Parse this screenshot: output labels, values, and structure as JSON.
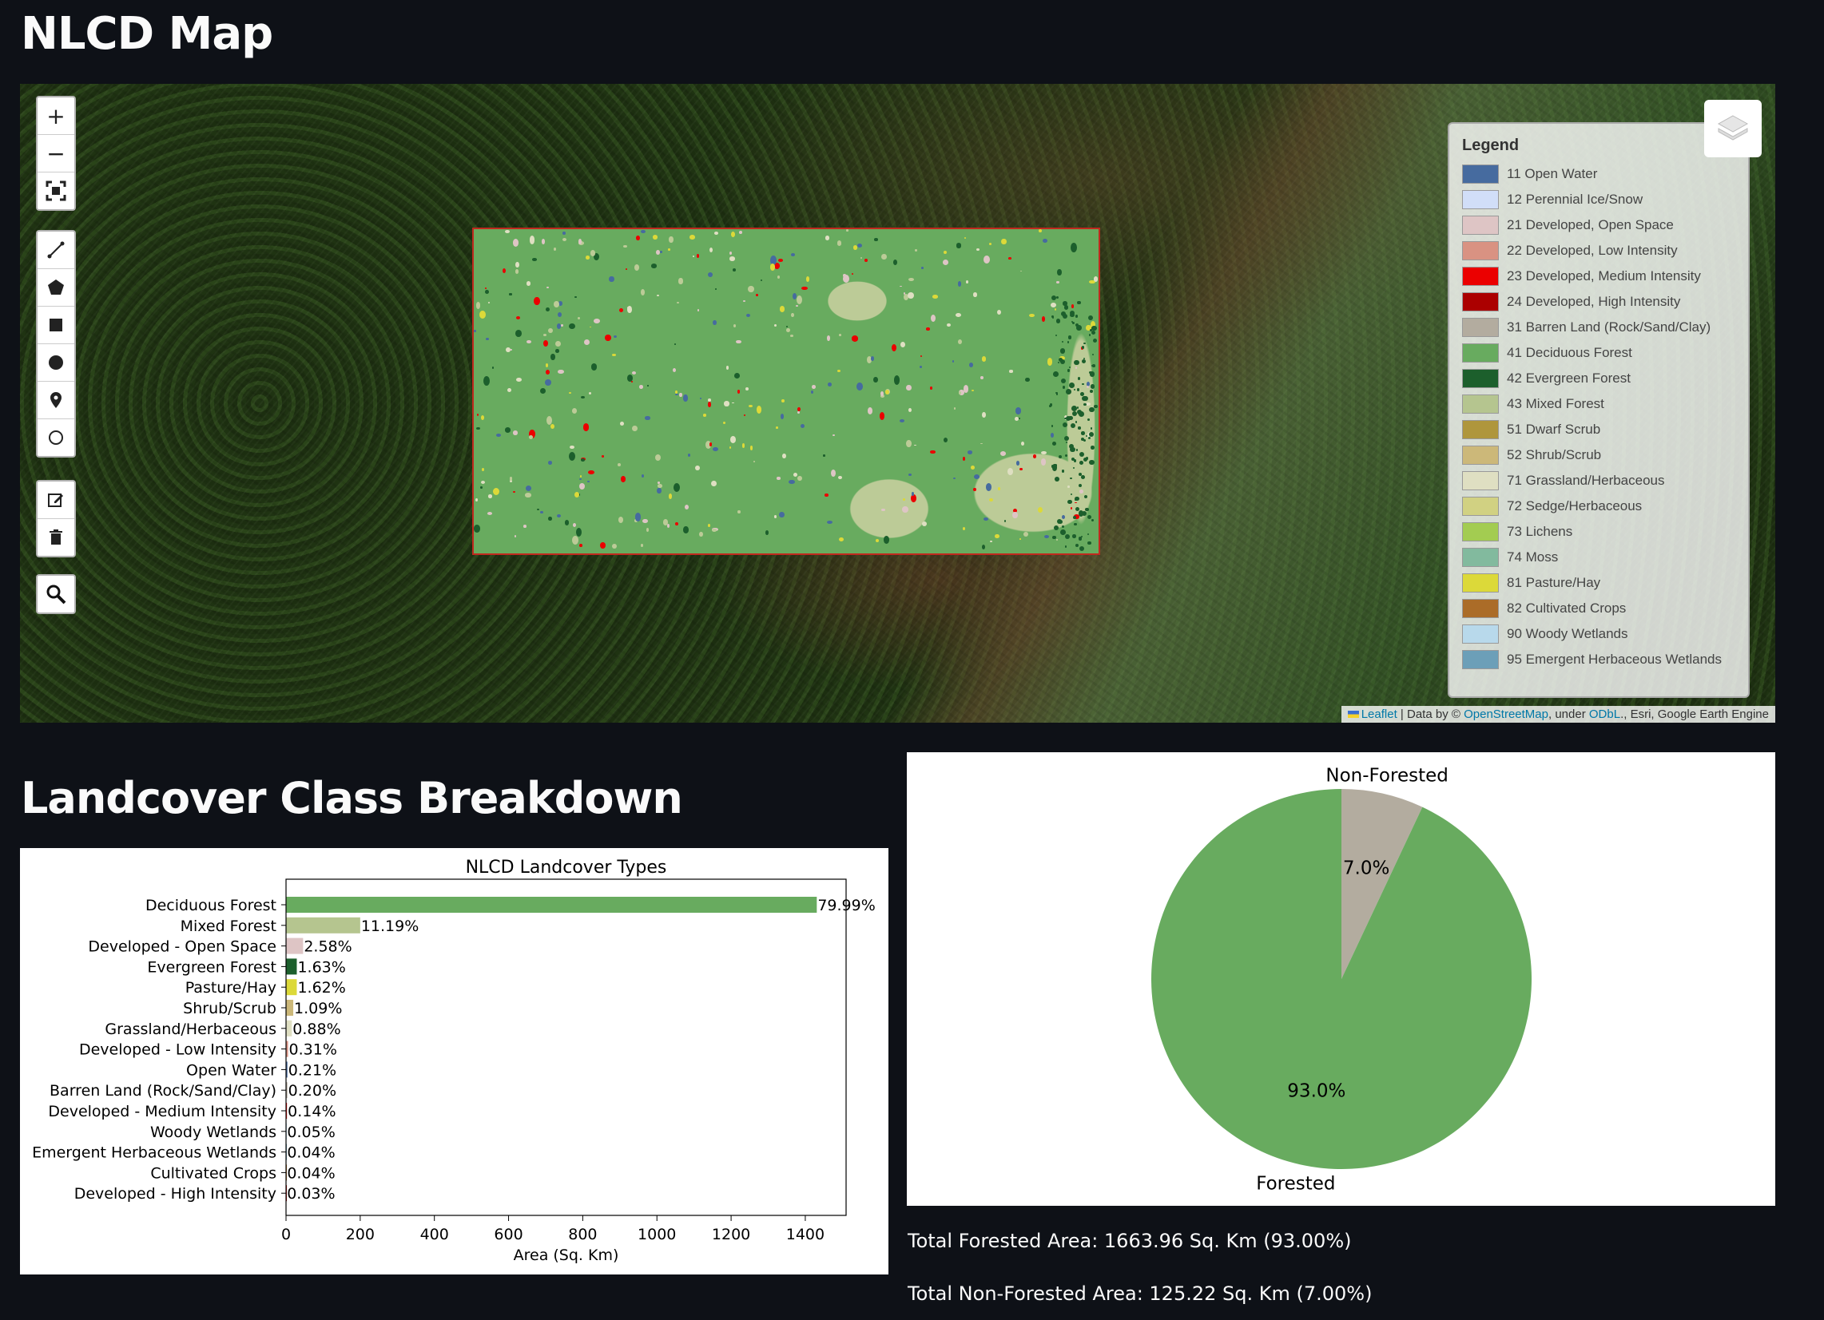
{
  "page": {
    "title": "NLCD Map",
    "section_title": "Landcover Class Breakdown"
  },
  "map": {
    "controls": {
      "zoom_in": "+",
      "zoom_out": "−"
    },
    "legend": {
      "title": "Legend",
      "items": [
        {
          "label": "11 Open Water",
          "color": "#466b9f"
        },
        {
          "label": "12 Perennial Ice/Snow",
          "color": "#d1def8"
        },
        {
          "label": "21 Developed, Open Space",
          "color": "#dec5c5"
        },
        {
          "label": "22 Developed, Low Intensity",
          "color": "#d99282"
        },
        {
          "label": "23 Developed, Medium Intensity",
          "color": "#eb0000"
        },
        {
          "label": "24 Developed, High Intensity",
          "color": "#ab0000"
        },
        {
          "label": "31 Barren Land (Rock/Sand/Clay)",
          "color": "#b3ac9f"
        },
        {
          "label": "41 Deciduous Forest",
          "color": "#68ab5f"
        },
        {
          "label": "42 Evergreen Forest",
          "color": "#1c5f2c"
        },
        {
          "label": "43 Mixed Forest",
          "color": "#b5c58f"
        },
        {
          "label": "51 Dwarf Scrub",
          "color": "#af963c"
        },
        {
          "label": "52 Shrub/Scrub",
          "color": "#ccb879"
        },
        {
          "label": "71 Grassland/Herbaceous",
          "color": "#dfdfc2"
        },
        {
          "label": "72 Sedge/Herbaceous",
          "color": "#d1d182"
        },
        {
          "label": "73 Lichens",
          "color": "#a3cc51"
        },
        {
          "label": "74 Moss",
          "color": "#82ba9e"
        },
        {
          "label": "81 Pasture/Hay",
          "color": "#dcd939"
        },
        {
          "label": "82 Cultivated Crops",
          "color": "#ab6c28"
        },
        {
          "label": "90 Woody Wetlands",
          "color": "#b8d9eb"
        },
        {
          "label": "95 Emergent Herbaceous Wetlands",
          "color": "#6c9fb8"
        }
      ]
    },
    "attribution": {
      "leaflet": "Leaflet",
      "sep1": " | Data by © ",
      "osm": "OpenStreetMap",
      "under": ", under ",
      "odbl": "ODbL",
      "rest": "., Esri, Google Earth Engine"
    }
  },
  "chart_data": [
    {
      "type": "bar",
      "orientation": "horizontal",
      "title": "NLCD Landcover Types",
      "xlabel": "Area (Sq. Km)",
      "ylabel": "",
      "xlim": [
        0,
        1510
      ],
      "xticks": [
        0,
        200,
        400,
        600,
        800,
        1000,
        1200,
        1400
      ],
      "categories": [
        "Deciduous Forest",
        "Mixed Forest",
        "Developed - Open Space",
        "Evergreen Forest",
        "Pasture/Hay",
        "Shrub/Scrub",
        "Grassland/Herbaceous",
        "Developed - Low Intensity",
        "Open Water",
        "Barren Land (Rock/Sand/Clay)",
        "Developed - Medium Intensity",
        "Woody Wetlands",
        "Emergent Herbaceous Wetlands",
        "Cultivated Crops",
        "Developed - High Intensity"
      ],
      "values": [
        1431,
        200,
        46,
        29,
        29,
        19.5,
        15.7,
        5.5,
        3.8,
        3.6,
        2.5,
        0.9,
        0.7,
        0.7,
        0.5
      ],
      "labels": [
        "79.99%",
        "11.19%",
        "2.58%",
        "1.63%",
        "1.62%",
        "1.09%",
        "0.88%",
        "0.31%",
        "0.21%",
        "0.20%",
        "0.14%",
        "0.05%",
        "0.04%",
        "0.04%",
        "0.03%"
      ],
      "colors": [
        "#68ab5f",
        "#b5c58f",
        "#dec5c5",
        "#1c5f2c",
        "#dcd939",
        "#ccb879",
        "#dfdfc2",
        "#d99282",
        "#466b9f",
        "#b3ac9f",
        "#eb0000",
        "#b8d9eb",
        "#6c9fb8",
        "#ab6c28",
        "#ab0000"
      ]
    },
    {
      "type": "pie",
      "categories": [
        "Non-Forested",
        "Forested"
      ],
      "values": [
        7.0,
        93.0
      ],
      "labels": [
        "7.0%",
        "93.0%"
      ],
      "colors": [
        "#b3ac9f",
        "#68ab5f"
      ]
    }
  ],
  "totals": {
    "forested": "Total Forested Area: 1663.96 Sq. Km (93.00%)",
    "non_forested": "Total Non-Forested Area: 125.22 Sq. Km (7.00%)"
  }
}
